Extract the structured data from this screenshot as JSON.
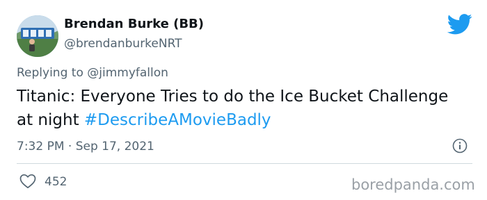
{
  "author": {
    "display_name": "Brendan Burke (BB)",
    "handle": "@brendanburkeNRT",
    "avatar": "avatar-photo"
  },
  "reply": {
    "prefix": "Replying to",
    "mention": "@jimmyfallon"
  },
  "tweet": {
    "text": "Titanic: Everyone Tries to do the Ice Bucket Challenge at night ",
    "hashtag": "#DescribeAMovieBadly"
  },
  "meta": {
    "time": "7:32 PM",
    "separator": "·",
    "date": "Sep 17, 2021"
  },
  "actions": {
    "likes": "452"
  },
  "watermark": "boredpanda.com",
  "icons": {
    "platform": "twitter-bird-icon",
    "info": "info-icon",
    "like": "heart-icon"
  },
  "colors": {
    "accent": "#1d9bf0",
    "text": "#0f1419",
    "muted": "#536471",
    "divider": "#cfd9de"
  }
}
